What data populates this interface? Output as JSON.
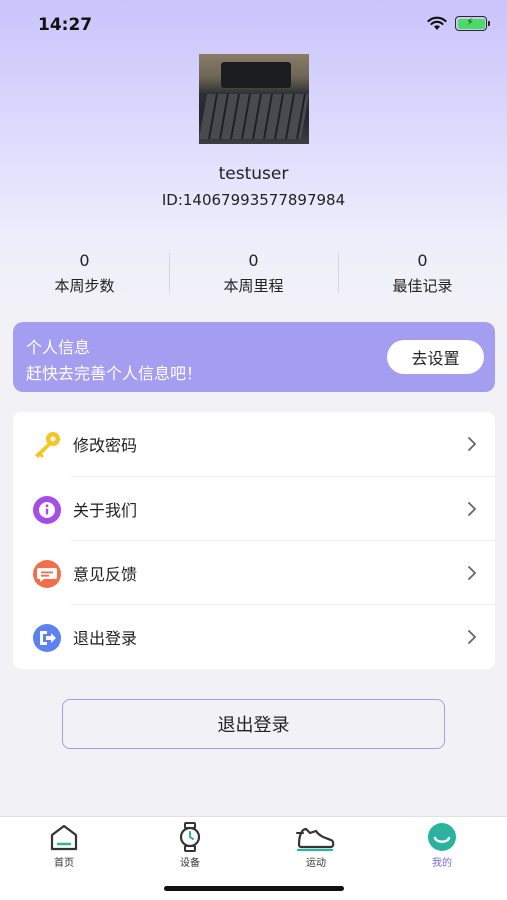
{
  "status_bar": {
    "time": "14:27",
    "wifi_icon": "wifi-icon",
    "battery_icon": "battery-charging-icon"
  },
  "profile": {
    "avatar_icon": "avatar-photo-keyboard",
    "username": "testuser",
    "id": "ID:14067993577897984"
  },
  "stats": [
    {
      "value": "0",
      "label": "本周步数"
    },
    {
      "value": "0",
      "label": "本周里程"
    },
    {
      "value": "0",
      "label": "最佳记录"
    }
  ],
  "info_card": {
    "title": "个人信息",
    "subtitle": "赶快去完善个人信息吧！",
    "button": "去设置",
    "color": "#a49df0"
  },
  "menu": [
    {
      "label": "修改密码",
      "icon": "key-icon"
    },
    {
      "label": "关于我们",
      "icon": "info-icon"
    },
    {
      "label": "意见反馈",
      "icon": "feedback-icon"
    },
    {
      "label": "退出登录",
      "icon": "exit-icon"
    }
  ],
  "logout_button": "退出登录",
  "tabs": [
    {
      "label": "首页",
      "icon": "home-icon",
      "active": false
    },
    {
      "label": "设备",
      "icon": "watch-icon",
      "active": false
    },
    {
      "label": "运动",
      "icon": "shoe-icon",
      "active": false
    },
    {
      "label": "我的",
      "icon": "profile-icon",
      "active": true
    }
  ],
  "colors": {
    "accent": "#a49df0",
    "active_tab": "#7a6bdd",
    "key": "#f3c623",
    "info": "#a64de8",
    "feedback": "#f26f4c",
    "exit": "#5b82f0"
  }
}
